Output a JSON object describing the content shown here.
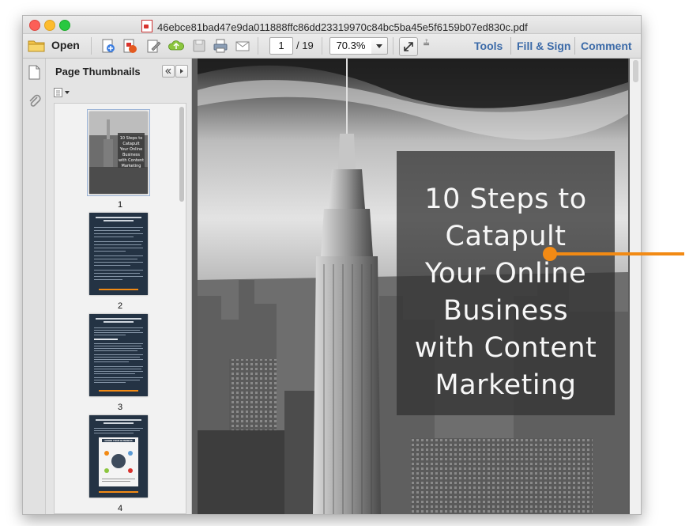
{
  "window": {
    "title": "46ebce81bad47e9da011888ffc86dd23319970c84bc5ba45e5f6159b07ed830c.pdf"
  },
  "toolbar": {
    "open_label": "Open",
    "page_current": "1",
    "page_total": "/ 19",
    "zoom": "70.3%",
    "tools_label": "Tools",
    "fill_sign_label": "Fill & Sign",
    "comment_label": "Comment"
  },
  "sidebar": {
    "panel_title": "Page Thumbnails",
    "thumbnails": [
      {
        "page": "1",
        "title": "10 Steps to Catapult Your Online Business with Content Marketing"
      },
      {
        "page": "2",
        "title": "10 Steps to Catapult Your Online Business with Content Marketing"
      },
      {
        "page": "3",
        "title": "10 Steps to Catapult Your Online Business with Content Marketing"
      },
      {
        "page": "4",
        "title": "10 Steps to Catapult Your Online Business with Content Marketing"
      }
    ],
    "thumb4_banner": "GROW YOUR BUSINESS"
  },
  "document": {
    "cover_title_lines": [
      "10 Steps to",
      "Catapult",
      "Your Online",
      "Business",
      "with Content",
      "Marketing"
    ]
  },
  "colors": {
    "accent_link": "#3b6aa8",
    "callout": "#f28a14",
    "thumb_dark": "#243344"
  }
}
